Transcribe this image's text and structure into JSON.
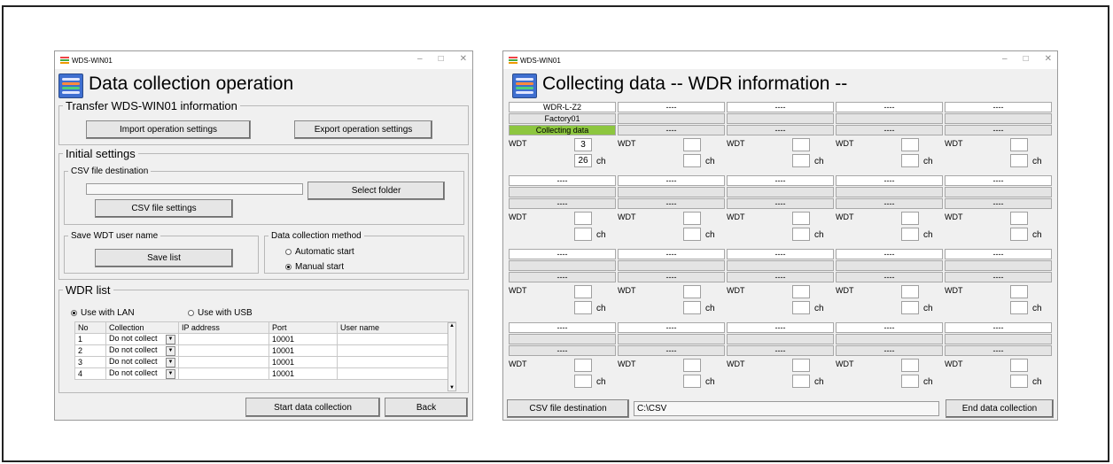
{
  "left": {
    "title_bar": "WDS-WIN01",
    "heading": "Data collection operation",
    "transfer_group": "Transfer WDS-WIN01 information",
    "import_button": "Import operation settings",
    "export_button": "Export operation settings",
    "initial_group": "Initial settings",
    "csv_group": "CSV file destination",
    "csv_path": "",
    "select_folder_button": "Select folder",
    "csv_settings_button": "CSV file settings",
    "save_group": "Save WDT user name",
    "save_list_button": "Save list",
    "method_group": "Data collection method",
    "automatic_start": "Automatic start",
    "manual_start": "Manual start",
    "wdr_group": "WDR list",
    "use_lan": "Use with LAN",
    "use_usb": "Use with USB",
    "columns": [
      "No",
      "Collection",
      "IP address",
      "Port",
      "User name"
    ],
    "rows": [
      {
        "no": "1",
        "collection": "Do not collect",
        "ip": "",
        "port": "10001",
        "user": ""
      },
      {
        "no": "2",
        "collection": "Do not collect",
        "ip": "",
        "port": "10001",
        "user": ""
      },
      {
        "no": "3",
        "collection": "Do not collect",
        "ip": "",
        "port": "10001",
        "user": ""
      },
      {
        "no": "4",
        "collection": "Do not collect",
        "ip": "",
        "port": "10001",
        "user": ""
      }
    ],
    "start_button": "Start data collection",
    "back_button": "Back"
  },
  "right": {
    "title_bar": "WDS-WIN01",
    "heading": "Collecting data -- WDR information --",
    "first_cell": {
      "name": "WDR-L-Z2",
      "location": "Factory01",
      "status": "Collecting data",
      "wdt_value": "3",
      "ch_value": "26"
    },
    "empty_text": "----",
    "wdt_label": "WDT",
    "ch_label": "ch",
    "csv_button": "CSV file destination",
    "csv_path": "C:\\CSV",
    "end_button": "End data collection"
  },
  "colors": {
    "status_green": "#8dc63f",
    "icon_blue": "#3f6fd0"
  }
}
